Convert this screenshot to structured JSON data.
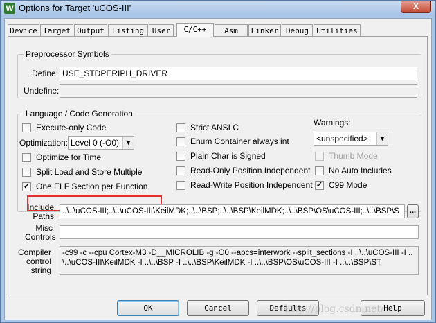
{
  "window": {
    "title": "Options for Target 'uCOS-III'",
    "app_icon": "W",
    "close_label": "X"
  },
  "tabs": [
    "Device",
    "Target",
    "Output",
    "Listing",
    "User",
    "C/C++",
    "Asm",
    "Linker",
    "Debug",
    "Utilities"
  ],
  "active_tab": "C/C++",
  "preprocessor": {
    "title": "Preprocessor Symbols",
    "define_label": "Define:",
    "define_value": "USE_STDPERIPH_DRIVER",
    "undefine_label": "Undefine:",
    "undefine_value": ""
  },
  "language": {
    "title": "Language / Code Generation",
    "execute_only": {
      "label": "Execute-only Code",
      "checked": false
    },
    "optimization_label": "Optimization:",
    "optimization_value": "Level 0 (-O0)",
    "optimize_time": {
      "label": "Optimize for Time",
      "checked": false
    },
    "split_load": {
      "label": "Split Load and Store Multiple",
      "checked": false
    },
    "one_elf": {
      "label": "One ELF Section per Function",
      "checked": true
    },
    "strict_ansi": {
      "label": "Strict ANSI C",
      "checked": false
    },
    "enum_container": {
      "label": "Enum Container always int",
      "checked": false
    },
    "plain_char": {
      "label": "Plain Char is Signed",
      "checked": false
    },
    "readonly_pi": {
      "label": "Read-Only Position Independent",
      "checked": false
    },
    "readwrite_pi": {
      "label": "Read-Write Position Independent",
      "checked": false
    },
    "warnings_label": "Warnings:",
    "warnings_value": "<unspecified>",
    "thumb_mode": {
      "label": "Thumb Mode",
      "checked": false,
      "disabled": true
    },
    "no_auto_includes": {
      "label": "No Auto Includes",
      "checked": false
    },
    "c99_mode": {
      "label": "C99 Mode",
      "checked": true
    }
  },
  "paths": {
    "include_label": "Include\nPaths",
    "include_value": "..\\..\\uCOS-III;..\\..\\uCOS-III\\KeilMDK;..\\..\\BSP;..\\..\\BSP\\KeilMDK;..\\..\\BSP\\OS\\uCOS-III;..\\..\\BSP\\S",
    "browse_label": "...",
    "misc_label": "Misc\nControls",
    "misc_value": "",
    "compiler_label": "Compiler\ncontrol\nstring",
    "compiler_value": "-c99 -c --cpu Cortex-M3 -D__MICROLIB -g -O0 --apcs=interwork --split_sections -I ..\\..\\uCOS-III -I ..\n\\..\\uCOS-III\\KeilMDK -I ..\\..\\BSP -I ..\\..\\BSP\\KeilMDK -I ..\\..\\BSP\\OS\\uCOS-III -I ..\\..\\BSP\\ST"
  },
  "buttons": {
    "ok": "OK",
    "cancel": "Cancel",
    "defaults": "Defaults",
    "help": "Help"
  },
  "watermark": "http://blog.csdn.net/"
}
